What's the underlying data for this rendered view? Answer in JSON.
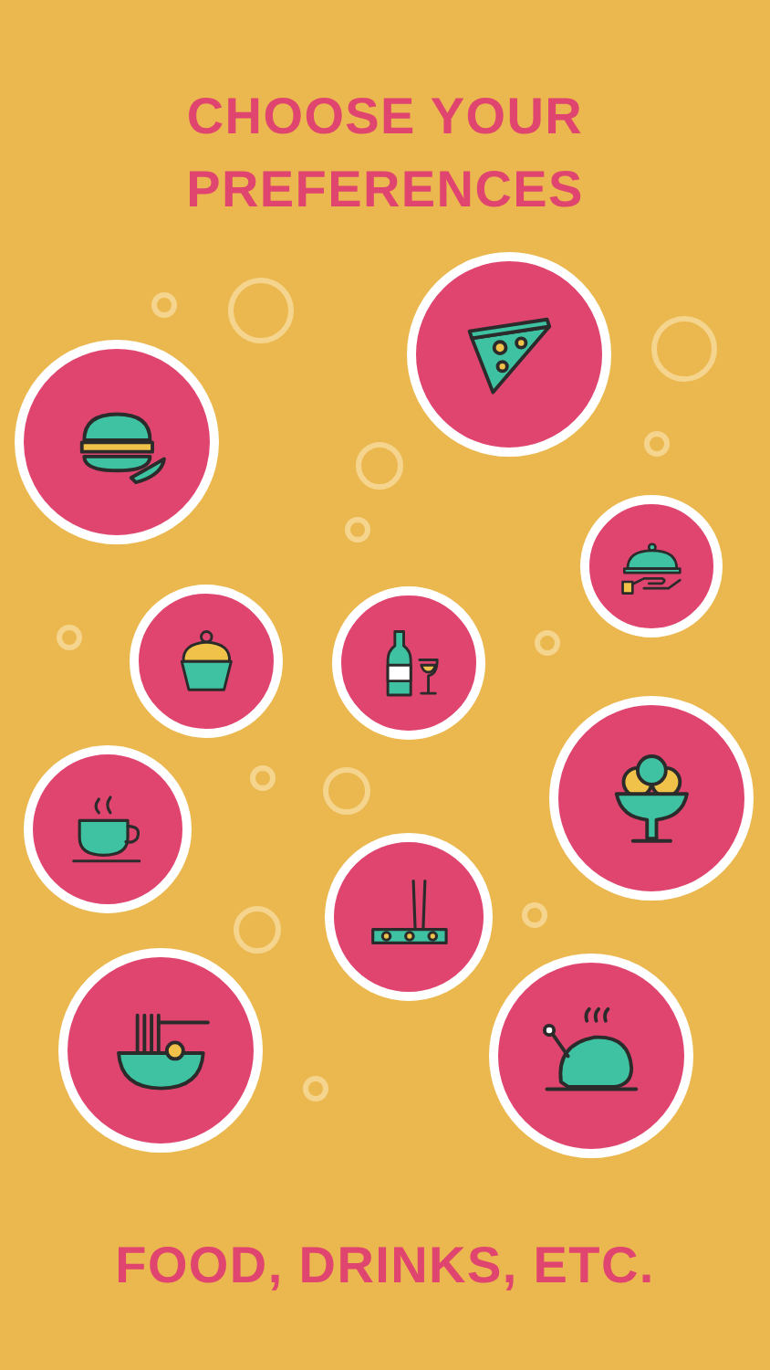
{
  "title": [
    "CHOOSE YOUR",
    "PREFERENCES"
  ],
  "footer": "FOOD, DRINKS, ETC."
}
